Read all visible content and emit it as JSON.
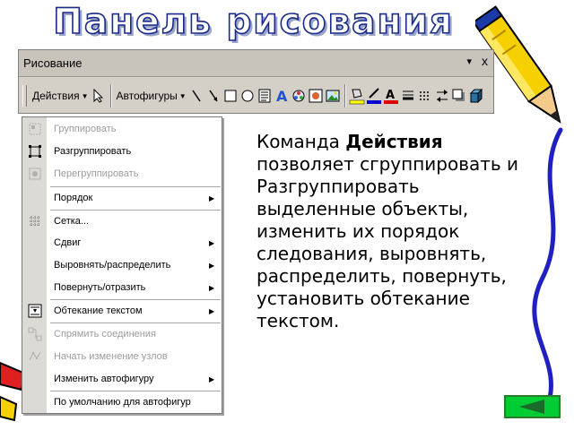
{
  "slide": {
    "title": "Панель рисования",
    "body_prefix": "Команда ",
    "body_bold": "Действия",
    "body_rest": " позволяет сгруппировать и Разгруппировать выделенные объекты, изменить их порядок следования, выровнять, распределить, повернуть, установить обтекание текстом."
  },
  "toolbar": {
    "caption": "Рисование",
    "caption_menu": "▾",
    "caption_close": "x",
    "actions_label": "Действия",
    "autoshapes_label": "Автофигуры",
    "icons": [
      "select-pointer-icon",
      "line-icon",
      "arrow-icon",
      "rectangle-icon",
      "oval-icon",
      "text-box-icon",
      "wordart-icon",
      "diagram-icon",
      "clip-art-icon",
      "picture-icon",
      "fill-color-icon",
      "line-color-icon",
      "font-color-icon",
      "line-style-icon",
      "dash-style-icon",
      "arrow-style-icon",
      "shadow-icon",
      "3d-icon"
    ]
  },
  "menu": {
    "items": [
      {
        "label": "Группировать",
        "enabled": false,
        "submenu": false
      },
      {
        "label": "Разгруппировать",
        "enabled": true,
        "submenu": false
      },
      {
        "label": "Перегруппировать",
        "enabled": false,
        "submenu": false
      },
      {
        "label": "Порядок",
        "enabled": true,
        "submenu": true
      },
      {
        "label": "Сетка...",
        "enabled": true,
        "submenu": false
      },
      {
        "label": "Сдвиг",
        "enabled": true,
        "submenu": true
      },
      {
        "label": "Выровнять/распределить",
        "enabled": true,
        "submenu": true
      },
      {
        "label": "Повернуть/отразить",
        "enabled": true,
        "submenu": true
      },
      {
        "label": "Обтекание текстом",
        "enabled": true,
        "submenu": true
      },
      {
        "label": "Спрямить соединения",
        "enabled": false,
        "submenu": false
      },
      {
        "label": "Начать изменение узлов",
        "enabled": false,
        "submenu": false
      },
      {
        "label": "Изменить автофигуру",
        "enabled": true,
        "submenu": true
      },
      {
        "label": "По умолчанию для автофигур",
        "enabled": true,
        "submenu": false
      }
    ],
    "submenu_glyph": "▶"
  },
  "colors": {
    "title_outline": "#1a2a8a",
    "toolbar_bg": "#d4d0c8",
    "back_button": "#00cc33",
    "disabled_text": "#9c9c9c"
  }
}
